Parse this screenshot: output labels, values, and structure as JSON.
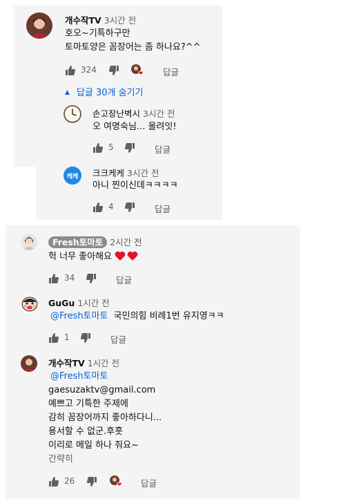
{
  "thread1": {
    "comment": {
      "author": "개수작TV",
      "time": "3시간 전",
      "lines": [
        "호오~기특하구만",
        "토마토양은 꼼장어는 좀 하나요?^^"
      ],
      "likes": "324",
      "reply_label": "답글"
    },
    "toggle_label": "답글 30개 숨기기",
    "replies": [
      {
        "author": "손고장난벽시",
        "time": "3시간 전",
        "text": "오 여명숙님... 올려잇!",
        "likes": "5",
        "reply_label": "답글"
      },
      {
        "author": "크크케케",
        "time": "3시간 전",
        "avatar_text": "케케",
        "text": "아니 찐이신데ㅋㅋㅋㅋ",
        "likes": "4",
        "reply_label": "답글"
      }
    ]
  },
  "thread2": {
    "comments": [
      {
        "author": "Fresh토마토",
        "time": "2시간 전",
        "text": "헉 너무 좋아해요",
        "emoji": "❤️❤️",
        "likes": "34",
        "reply_label": "답글"
      },
      {
        "author": "GuGu",
        "time": "1시간 전",
        "mention": "@Fresh토마토",
        "text": "국민의힘 비례1번 유지영ㅋㅋ",
        "likes": "1",
        "reply_label": "답글"
      },
      {
        "author": "개수작TV",
        "time": "1시간 전",
        "mention": "@Fresh토마토",
        "lines": [
          "gaesuzaktv@gmail.com",
          "예쁘고 기특한 주제에",
          "감히 꼼장어까지 좋아하다니...",
          "용서할 수 없군.후훗",
          "이리로 메일 하나 줘요~",
          "간략히"
        ],
        "likes": "26",
        "reply_label": "답글"
      }
    ]
  },
  "colors": {
    "panel": "#f4f4f4",
    "link": "#065fd4",
    "heart": "#ff0000",
    "meta": "#606060"
  }
}
